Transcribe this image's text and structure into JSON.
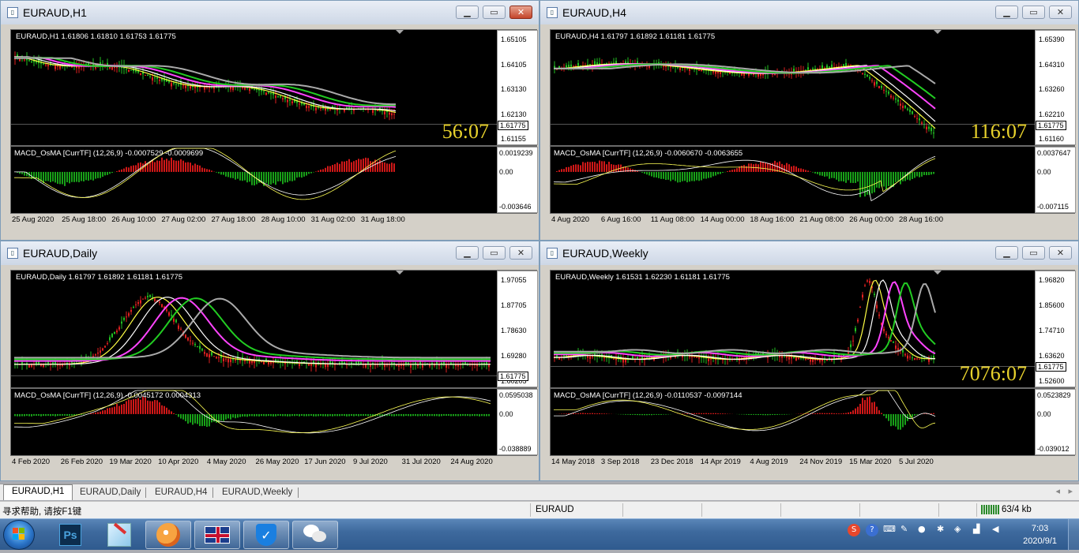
{
  "windows": [
    {
      "title": "EURAUD,H1",
      "ohlc": "EURAUD,H1  1.61806 1.61810 1.61753 1.61775",
      "prices": [
        "1.65105",
        "1.64105",
        "1.63130",
        "1.62130",
        "1.61155"
      ],
      "current_price": "1.61775",
      "macd": "MACD_OsMA [CurrTF] (12,26,9) -0.0007529 -0.0009699",
      "macd_levels": [
        "0.0019239",
        "0.00",
        "-0.003646"
      ],
      "timer": "56:07",
      "dates": [
        "25 Aug 2020",
        "25 Aug 18:00",
        "26 Aug 10:00",
        "27 Aug 02:00",
        "27 Aug 18:00",
        "28 Aug 10:00",
        "31 Aug 02:00",
        "31 Aug 18:00"
      ],
      "close_active": true
    },
    {
      "title": "EURAUD,H4",
      "ohlc": "EURAUD,H4  1.61797 1.61892 1.61181 1.61775",
      "prices": [
        "1.65390",
        "1.64310",
        "1.63260",
        "1.62210",
        "1.61160"
      ],
      "current_price": "1.61775",
      "macd": "MACD_OsMA [CurrTF] (12,26,9) -0.0060670 -0.0063655",
      "macd_levels": [
        "0.0037647",
        "0.00",
        "-0.007115"
      ],
      "timer": "116:07",
      "dates": [
        "4 Aug 2020",
        "6 Aug 16:00",
        "11 Aug 08:00",
        "14 Aug 00:00",
        "18 Aug 16:00",
        "21 Aug 08:00",
        "26 Aug 00:00",
        "28 Aug 16:00"
      ],
      "close_active": false
    },
    {
      "title": "EURAUD,Daily",
      "ohlc": "EURAUD,Daily  1.61797 1.61892 1.61181 1.61775",
      "prices": [
        "1.97055",
        "1.87705",
        "1.78630",
        "1.69280",
        "1.60205"
      ],
      "current_price": "1.61775",
      "macd": "MACD_OsMA [CurrTF] (12,26,9) -0.0045172 0.0004313",
      "macd_levels": [
        "0.0595038",
        "0.00",
        "-0.038889"
      ],
      "timer": "",
      "dates": [
        "4 Feb 2020",
        "26 Feb 2020",
        "19 Mar 2020",
        "10 Apr 2020",
        "4 May 2020",
        "26 May 2020",
        "17 Jun 2020",
        "9 Jul 2020",
        "31 Jul 2020",
        "24 Aug 2020"
      ],
      "close_active": false
    },
    {
      "title": "EURAUD,Weekly",
      "ohlc": "EURAUD,Weekly  1.61531 1.62230 1.61181 1.61775",
      "prices": [
        "1.96820",
        "1.85600",
        "1.74710",
        "1.63620",
        "1.52600"
      ],
      "current_price": "1.61775",
      "macd": "MACD_OsMA [CurrTF] (12,26,9) -0.0110537 -0.0097144",
      "macd_levels": [
        "0.0523829",
        "0.00",
        "-0.039012"
      ],
      "timer": "7076:07",
      "dates": [
        "14 May 2018",
        "3 Sep 2018",
        "23 Dec 2018",
        "14 Apr 2019",
        "4 Aug 2019",
        "24 Nov 2019",
        "15 Mar 2020",
        "5 Jul 2020"
      ],
      "close_active": false
    }
  ],
  "tabs": [
    "EURAUD,H1",
    "EURAUD,Daily",
    "EURAUD,H4",
    "EURAUD,Weekly"
  ],
  "status": {
    "help": "寻求帮助, 请按F1键",
    "symbol": "EURAUD",
    "traffic": "63/4 kb"
  },
  "taskbar": {
    "apps": [
      "start-orb",
      "photoshop",
      "paint",
      "browser",
      "metatrader",
      "security",
      "wechat"
    ],
    "ps_label": "Ps",
    "time": "7:03",
    "date": "2020/9/1"
  }
}
